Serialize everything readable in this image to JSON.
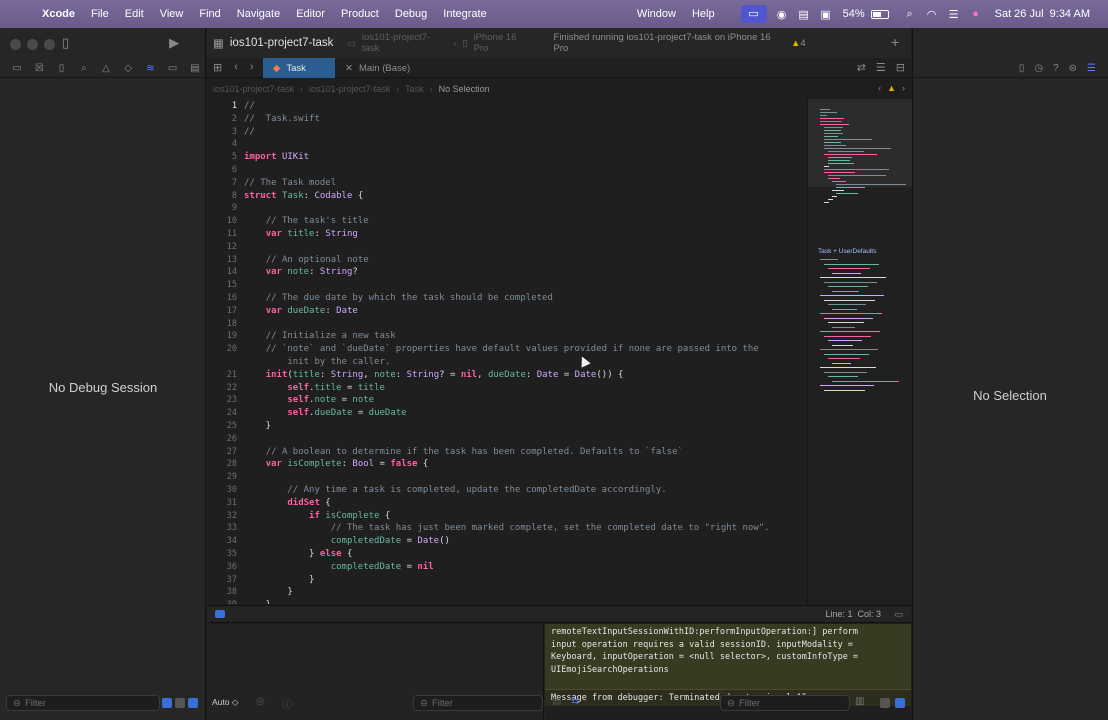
{
  "menubar": {
    "app": "Xcode",
    "items": [
      "File",
      "Edit",
      "View",
      "Find",
      "Navigate",
      "Editor",
      "Product",
      "Debug",
      "Integrate"
    ],
    "right_items": [
      "Window",
      "Help"
    ],
    "battery": "54%",
    "datetime": "Sat 26 Jul  9:34 AM",
    "battery_level": 0.54
  },
  "toolbar": {
    "project_title": "ios101-project7-task",
    "scheme": "ios101-project7-task",
    "device": "iPhone 16 Pro",
    "status": "Finished running ios101-project7-task on iPhone 16 Pro",
    "warnings": "4"
  },
  "tabs": [
    {
      "label": "Task",
      "active": true
    },
    {
      "label": "Main (Base)",
      "active": false
    }
  ],
  "jumpbar": {
    "items": [
      "ios101-project7-task",
      "ios101-project7-task",
      "Task"
    ],
    "selection": "No Selection"
  },
  "left_pane": {
    "message": "No Debug Session",
    "filter_placeholder": "Filter"
  },
  "right_pane": {
    "message": "No Selection"
  },
  "editor": {
    "current_line": "1",
    "status": "Line: 1  Col: 3"
  },
  "minimap": {
    "label": "Task + UserDefaults"
  },
  "code_lines": [
    {
      "n": "1",
      "text": "//"
    },
    {
      "n": "2",
      "text": "//  Task.swift"
    },
    {
      "n": "3",
      "text": "//"
    },
    {
      "n": "4",
      "text": ""
    },
    {
      "n": "5",
      "text": "import UIKit"
    },
    {
      "n": "6",
      "text": ""
    },
    {
      "n": "7",
      "text": "// The Task model"
    },
    {
      "n": "8",
      "text": "struct Task: Codable {"
    },
    {
      "n": "9",
      "text": ""
    },
    {
      "n": "10",
      "text": "    // The task's title"
    },
    {
      "n": "11",
      "text": "    var title: String"
    },
    {
      "n": "12",
      "text": ""
    },
    {
      "n": "13",
      "text": "    // An optional note"
    },
    {
      "n": "14",
      "text": "    var note: String?"
    },
    {
      "n": "15",
      "text": ""
    },
    {
      "n": "16",
      "text": "    // The due date by which the task should be completed"
    },
    {
      "n": "17",
      "text": "    var dueDate: Date"
    },
    {
      "n": "18",
      "text": ""
    },
    {
      "n": "19",
      "text": "    // Initialize a new task"
    },
    {
      "n": "20",
      "text": "    // `note` and `dueDate` properties have default values provided if none are passed into the"
    },
    {
      "n": "",
      "text": "        init by the caller."
    },
    {
      "n": "21",
      "text": "    init(title: String, note: String? = nil, dueDate: Date = Date()) {"
    },
    {
      "n": "22",
      "text": "        self.title = title"
    },
    {
      "n": "23",
      "text": "        self.note = note"
    },
    {
      "n": "24",
      "text": "        self.dueDate = dueDate"
    },
    {
      "n": "25",
      "text": "    }"
    },
    {
      "n": "26",
      "text": ""
    },
    {
      "n": "27",
      "text": "    // A boolean to determine if the task has been completed. Defaults to `false`"
    },
    {
      "n": "28",
      "text": "    var isComplete: Bool = false {"
    },
    {
      "n": "29",
      "text": ""
    },
    {
      "n": "30",
      "text": "        // Any time a task is completed, update the completedDate accordingly."
    },
    {
      "n": "31",
      "text": "        didSet {"
    },
    {
      "n": "32",
      "text": "            if isComplete {"
    },
    {
      "n": "33",
      "text": "                // The task has just been marked complete, set the completed date to \"right now\"."
    },
    {
      "n": "34",
      "text": "                completedDate = Date()"
    },
    {
      "n": "35",
      "text": "            } else {"
    },
    {
      "n": "36",
      "text": "                completedDate = nil"
    },
    {
      "n": "37",
      "text": "            }"
    },
    {
      "n": "38",
      "text": "        }"
    },
    {
      "n": "39",
      "text": "    }"
    }
  ],
  "debug": {
    "auto_label": "Auto ◇",
    "console_message": "remoteTextInputSessionWithID:performInputOperation:] perform\ninput operation requires a valid sessionID. inputModality =\nKeyboard, inputOperation = <null selector>, customInfoType =\nUIEmojiSearchOperations",
    "debugger_message": "Message from debugger: Terminated due to signal 15",
    "filter_placeholder": "Filter"
  },
  "colors": {
    "keyword": "#fc5fa3",
    "comment": "#7f8c98",
    "type": "#d0a8ff",
    "property": "#67b7a4",
    "accent": "#2c5d90"
  }
}
